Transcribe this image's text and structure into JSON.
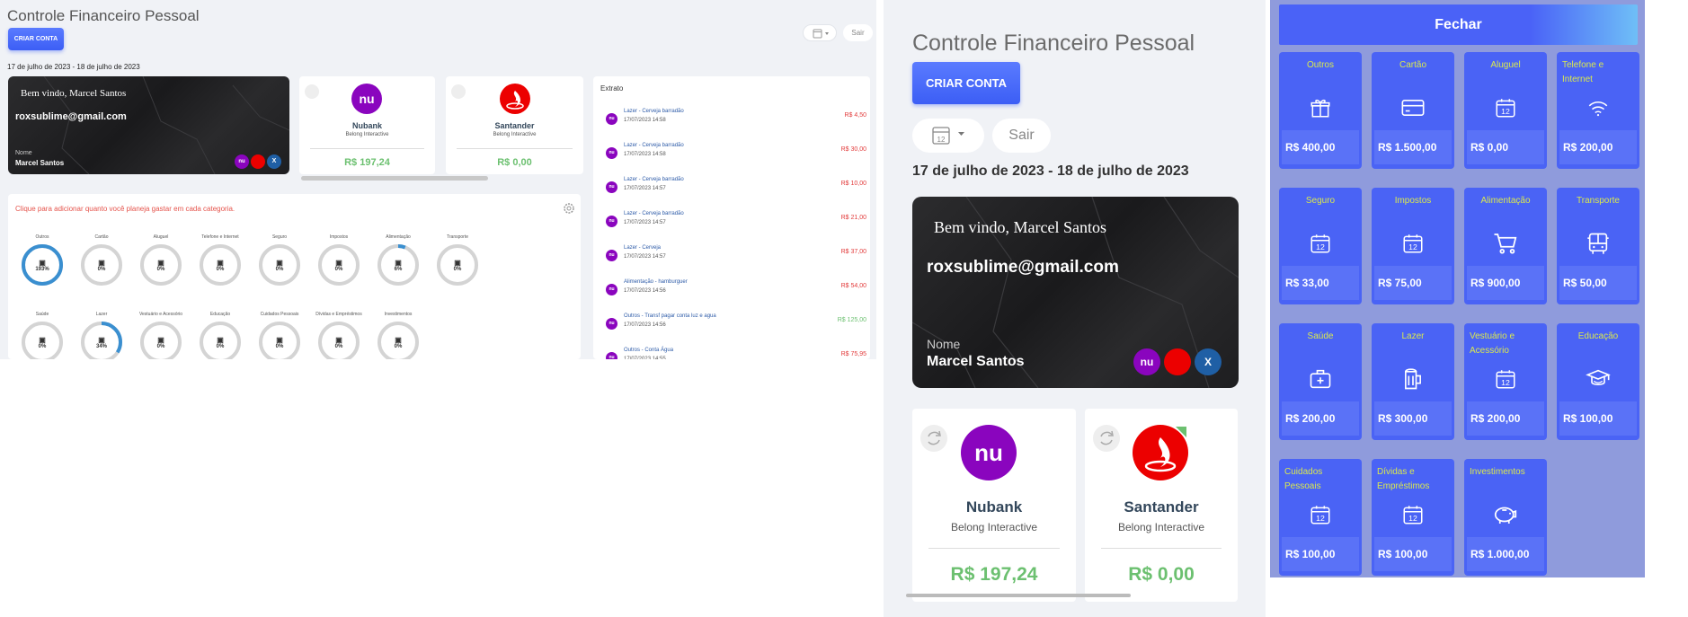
{
  "app": {
    "title": "Controle Financeiro Pessoal",
    "create_account": "CRIAR CONTA",
    "exit": "Sair",
    "date_range": "17 de julho de 2023 - 18 de julho de 2023",
    "calendar_day": "12"
  },
  "user": {
    "welcome": "Bem vindo, Marcel Santos",
    "email": "roxsublime@gmail.com",
    "name_label": "Nome",
    "name": "Marcel Santos"
  },
  "banks": [
    {
      "name": "Nubank",
      "company": "Belong Interactive",
      "balance": "R$ 197,24",
      "logo_text": "nu",
      "color": "#8a05be"
    },
    {
      "name": "Santander",
      "company": "Belong Interactive",
      "balance": "R$ 0,00",
      "logo_text": "",
      "color": "#ec0000"
    }
  ],
  "categories_panel": {
    "hint": "Clique para adicionar quanto você planeja gastar em cada categoria.",
    "items": [
      {
        "name": "Outros",
        "percent": "193%",
        "progress": 1.0
      },
      {
        "name": "Cartão",
        "percent": "0%",
        "progress": 0
      },
      {
        "name": "Aluguel",
        "percent": "0%",
        "progress": 0
      },
      {
        "name": "Telefone e Internet",
        "percent": "0%",
        "progress": 0
      },
      {
        "name": "Seguro",
        "percent": "0%",
        "progress": 0
      },
      {
        "name": "Impostos",
        "percent": "0%",
        "progress": 0
      },
      {
        "name": "Alimentação",
        "percent": "6%",
        "progress": 0.06
      },
      {
        "name": "Transporte",
        "percent": "0%",
        "progress": 0
      },
      {
        "name": "Saúde",
        "percent": "0%",
        "progress": 0
      },
      {
        "name": "Lazer",
        "percent": "34%",
        "progress": 0.34
      },
      {
        "name": "Vestuário e Acessório",
        "percent": "0%",
        "progress": 0
      },
      {
        "name": "Educação",
        "percent": "0%",
        "progress": 0
      },
      {
        "name": "Cuidados Pessoais",
        "percent": "0%",
        "progress": 0
      },
      {
        "name": "Dívidas e Empréstimos",
        "percent": "0%",
        "progress": 0
      },
      {
        "name": "Investimentos",
        "percent": "0%",
        "progress": 0
      }
    ]
  },
  "extrato": {
    "title": "Extrato",
    "transactions": [
      {
        "desc": "Lazer - Cerveja barradão",
        "date": "17/07/2023 14:58",
        "value": "R$ 4,50",
        "type": "out"
      },
      {
        "desc": "Lazer - Cerveja barradão",
        "date": "17/07/2023 14:58",
        "value": "R$ 30,00",
        "type": "out"
      },
      {
        "desc": "Lazer - Cerveja barradão",
        "date": "17/07/2023 14:57",
        "value": "R$ 10,00",
        "type": "out"
      },
      {
        "desc": "Lazer - Cerveja barradão",
        "date": "17/07/2023 14:57",
        "value": "R$ 21,00",
        "type": "out"
      },
      {
        "desc": "Lazer - Cerveja",
        "date": "17/07/2023 14:57",
        "value": "R$ 37,00",
        "type": "out"
      },
      {
        "desc": "Alimentação - hamburguer",
        "date": "17/07/2023 14:56",
        "value": "R$ 54,00",
        "type": "out"
      },
      {
        "desc": "Outros - Transf pagar conta luz e agua",
        "date": "17/07/2023 14:56",
        "value": "R$ 125,00",
        "type": "in"
      },
      {
        "desc": "Outros - Conta Água",
        "date": "17/07/2023 14:55",
        "value": "R$ 75,95",
        "type": "out"
      }
    ]
  },
  "budget_panel": {
    "close": "Fechar",
    "tiles": [
      {
        "name": "Outros",
        "value": "R$ 400,00",
        "icon": "gift-icon"
      },
      {
        "name": "Cartão",
        "value": "R$ 1.500,00",
        "icon": "credit-card-icon"
      },
      {
        "name": "Aluguel",
        "value": "R$ 0,00",
        "icon": "calendar-icon"
      },
      {
        "name": "Telefone e Internet",
        "value": "R$ 200,00",
        "icon": "wifi-icon"
      },
      {
        "name": "Seguro",
        "value": "R$ 33,00",
        "icon": "calendar-icon"
      },
      {
        "name": "Impostos",
        "value": "R$ 75,00",
        "icon": "calendar-icon"
      },
      {
        "name": "Alimentação",
        "value": "R$ 900,00",
        "icon": "cart-icon"
      },
      {
        "name": "Transporte",
        "value": "R$ 50,00",
        "icon": "bus-icon"
      },
      {
        "name": "Saúde",
        "value": "R$ 200,00",
        "icon": "medical-kit-icon"
      },
      {
        "name": "Lazer",
        "value": "R$ 300,00",
        "icon": "beer-mug-icon"
      },
      {
        "name": "Vestuário e Acessório",
        "value": "R$ 200,00",
        "icon": "calendar-icon"
      },
      {
        "name": "Educação",
        "value": "R$ 100,00",
        "icon": "graduation-cap-icon"
      },
      {
        "name": "Cuidados Pessoais",
        "value": "R$ 100,00",
        "icon": "calendar-icon"
      },
      {
        "name": "Dívidas e Empréstimos",
        "value": "R$ 100,00",
        "icon": "calendar-icon"
      },
      {
        "name": "Investimentos",
        "value": "R$ 1.000,00",
        "icon": "piggy-bank-icon"
      }
    ]
  },
  "colors": {
    "accent": "#4a63f5",
    "positive": "#6cc070",
    "negative": "#e23b3b",
    "tile_label": "#d9e84f",
    "nubank": "#8a05be",
    "santander": "#ec0000"
  }
}
